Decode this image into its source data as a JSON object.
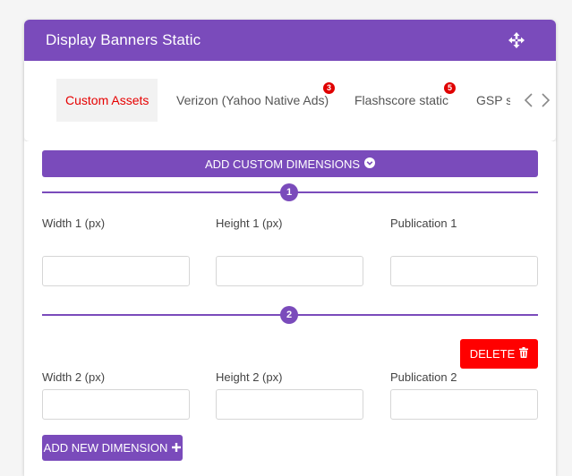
{
  "card": {
    "title": "Display Banners Static"
  },
  "tabs": [
    {
      "label": "Custom Assets",
      "active": true,
      "badge": ""
    },
    {
      "label": "Verizon (Yahoo Native Ads)",
      "active": false,
      "badge": "3"
    },
    {
      "label": "Flashscore static",
      "active": false,
      "badge": "5"
    },
    {
      "label": "GSP s",
      "active": false,
      "badge": ""
    }
  ],
  "buttons": {
    "add_custom_dimensions": "ADD CUSTOM DIMENSIONS",
    "delete": "DELETE",
    "add_new_dimension": "ADD NEW DIMENSION"
  },
  "dimensions": [
    {
      "step": "1",
      "width_label": "Width 1 (px)",
      "height_label": "Height 1 (px)",
      "publication_label": "Publication 1",
      "width_value": "",
      "height_value": "",
      "publication_value": ""
    },
    {
      "step": "2",
      "width_label": "Width 2 (px)",
      "height_label": "Height 2 (px)",
      "publication_label": "Publication 2",
      "width_value": "",
      "height_value": "",
      "publication_value": ""
    }
  ],
  "colors": {
    "primary": "#7a4bbb",
    "danger": "#ff0000",
    "active_tab_text": "#e60000",
    "badge": "#e00000"
  },
  "icons": {
    "move": "move-icon",
    "dropdown": "chevron-circle-down-icon",
    "delete": "trash-icon",
    "add": "plus-icon",
    "prev": "chevron-left-icon",
    "next": "chevron-right-icon"
  }
}
